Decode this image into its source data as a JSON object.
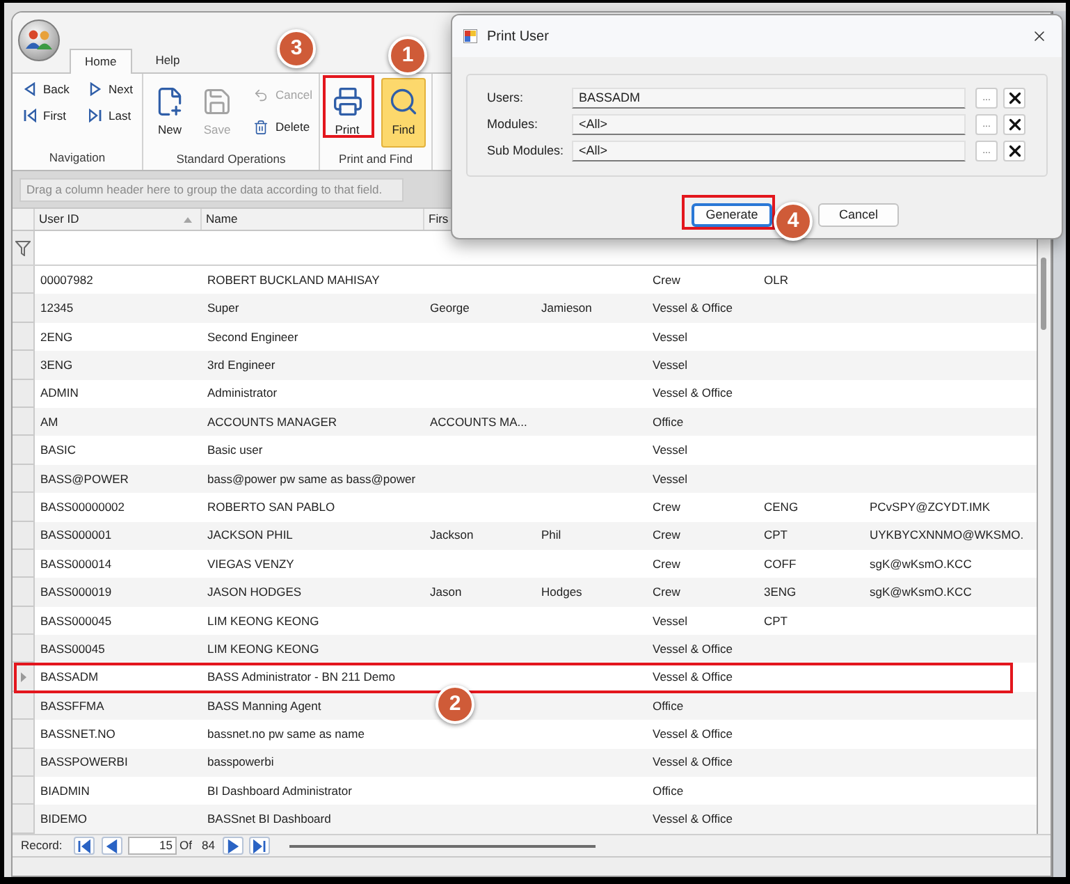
{
  "ribbon": {
    "tabs": [
      {
        "label": "Home",
        "selected": true
      },
      {
        "label": "Help",
        "selected": false
      }
    ],
    "groups": [
      {
        "label": "Navigation",
        "items": [
          {
            "label": "Back",
            "kind": "small",
            "disabled": false,
            "highlighted": false
          },
          {
            "label": "Next",
            "kind": "small",
            "disabled": false,
            "highlighted": false
          },
          {
            "label": "First",
            "kind": "small",
            "disabled": false,
            "highlighted": false
          },
          {
            "label": "Last",
            "kind": "small",
            "disabled": false,
            "highlighted": false
          }
        ]
      },
      {
        "label": "Standard Operations",
        "items": [
          {
            "label": "New",
            "kind": "large",
            "disabled": false,
            "highlighted": false
          },
          {
            "label": "Save",
            "kind": "large",
            "disabled": true,
            "highlighted": false
          },
          {
            "label": "Cancel",
            "kind": "small",
            "disabled": true,
            "highlighted": false
          },
          {
            "label": "Delete",
            "kind": "small",
            "disabled": false,
            "highlighted": false
          }
        ]
      },
      {
        "label": "Print and Find",
        "items": [
          {
            "label": "Print",
            "kind": "large",
            "disabled": false,
            "highlighted": false
          },
          {
            "label": "Find",
            "kind": "large",
            "disabled": false,
            "highlighted": true
          }
        ]
      }
    ]
  },
  "grid": {
    "group_panel": "Drag a column header here to group the data according to that field.",
    "columns": [
      {
        "label": "User ID",
        "sorted": true
      },
      {
        "label": "Name",
        "sorted": false
      },
      {
        "label": "Firs"
      }
    ],
    "rows": [
      {
        "user_id": "00007982",
        "name": "ROBERT BUCKLAND MAHISAY",
        "column_5": "Crew",
        "column_6": "OLR",
        "selected": false
      },
      {
        "user_id": "12345",
        "name": "Super",
        "column_3": "George",
        "column_4": "Jamieson",
        "column_5": "Vessel & Office",
        "selected": false
      },
      {
        "user_id": "2ENG",
        "name": "Second Engineer",
        "column_5": "Vessel",
        "selected": false
      },
      {
        "user_id": "3ENG",
        "name": "3rd Engineer",
        "column_5": "Vessel",
        "selected": false
      },
      {
        "user_id": "ADMIN",
        "name": "Administrator",
        "column_5": "Vessel & Office",
        "selected": false
      },
      {
        "user_id": "AM",
        "name": "ACCOUNTS MANAGER",
        "column_3": "ACCOUNTS MA...",
        "column_5": "Office",
        "selected": false
      },
      {
        "user_id": "BASIC",
        "name": "Basic user",
        "column_5": "Vessel",
        "selected": false
      },
      {
        "user_id": "BASS@POWER",
        "name": "bass@power pw same as bass@power",
        "column_5": "Vessel",
        "selected": false
      },
      {
        "user_id": "BASS00000002",
        "name": "ROBERTO SAN PABLO",
        "column_5": "Crew",
        "column_6": "CENG",
        "column_7": "PCvSPY@ZCYDT.IMK",
        "selected": false
      },
      {
        "user_id": "BASS000001",
        "name": "JACKSON PHIL",
        "column_3": "Jackson",
        "column_4": "Phil",
        "column_5": "Crew",
        "column_6": "CPT",
        "column_7": "UYKBYCXNNMO@WKSMO.",
        "selected": false
      },
      {
        "user_id": "BASS000014",
        "name": "VIEGAS VENZY",
        "column_5": "Crew",
        "column_6": "COFF",
        "column_7": "sgK@wKsmO.KCC",
        "selected": false
      },
      {
        "user_id": "BASS000019",
        "name": "JASON HODGES",
        "column_3": "Jason",
        "column_4": "Hodges",
        "column_5": "Crew",
        "column_6": "3ENG",
        "column_7": "sgK@wKsmO.KCC",
        "selected": false
      },
      {
        "user_id": "BASS000045",
        "name": "LIM KEONG KEONG",
        "column_5": "Vessel",
        "column_6": "CPT",
        "selected": false
      },
      {
        "user_id": "BASS00045",
        "name": "LIM KEONG KEONG",
        "column_5": "Vessel & Office",
        "selected": false
      },
      {
        "user_id": "BASSADM",
        "name": "BASS Administrator - BN 211 Demo",
        "column_5": "Vessel & Office",
        "selected": true
      },
      {
        "user_id": "BASSFFMA",
        "name": "BASS Manning Agent",
        "column_5": "Office",
        "selected": false
      },
      {
        "user_id": "BASSNET.NO",
        "name": "bassnet.no pw same as name",
        "column_5": "Vessel & Office",
        "selected": false
      },
      {
        "user_id": "BASSPOWERBI",
        "name": "basspowerbi",
        "column_5": "Vessel & Office",
        "selected": false
      },
      {
        "user_id": "BIADMIN",
        "name": "BI Dashboard Administrator",
        "column_5": "Office",
        "selected": false
      },
      {
        "user_id": "BIDEMO",
        "name": "BASSnet BI Dashboard",
        "column_5": "Vessel & Office",
        "selected": false
      }
    ],
    "navigator": {
      "label": "Record:",
      "current": "15",
      "of_label": "Of",
      "total": "84"
    }
  },
  "dialog": {
    "title": "Print User",
    "fields": [
      {
        "label": "Users:",
        "value": "BASSADM",
        "browse": "..."
      },
      {
        "label": "Modules:",
        "value": "<All>",
        "browse": "..."
      },
      {
        "label": "Sub Modules:",
        "value": "<All>",
        "browse": "..."
      }
    ],
    "buttons": [
      {
        "label": "Generate",
        "focused": true
      },
      {
        "label": "Cancel",
        "focused": false
      }
    ]
  },
  "callouts": [
    {
      "number": "3"
    },
    {
      "number": "1"
    },
    {
      "number": "4"
    },
    {
      "number": "2"
    }
  ]
}
